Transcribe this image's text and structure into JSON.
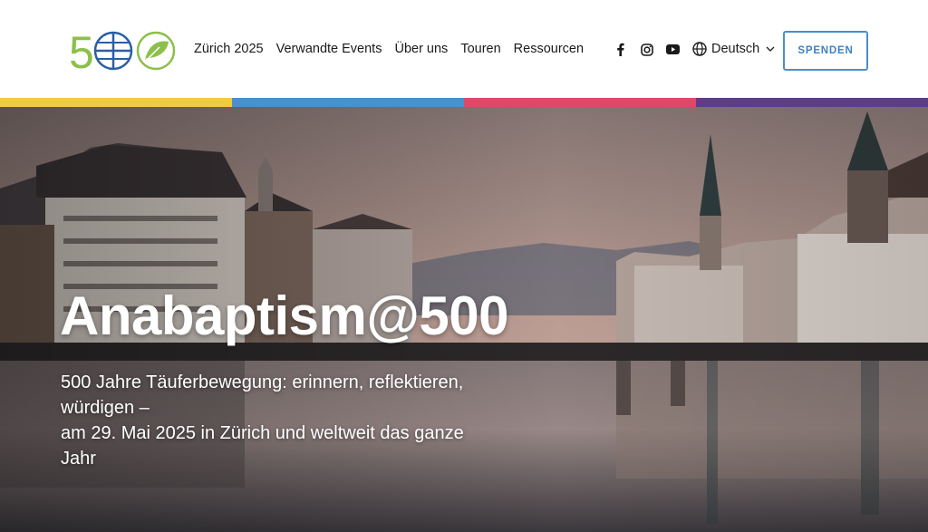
{
  "logo": {
    "text": "500",
    "icon": "anabaptism-500-logo",
    "colors": {
      "green": "#8cc04b",
      "blue": "#2b5fa3"
    }
  },
  "nav": {
    "items": [
      {
        "label": "Zürich 2025"
      },
      {
        "label": "Verwandte Events"
      },
      {
        "label": "Über uns"
      },
      {
        "label": "Touren"
      },
      {
        "label": "Ressourcen"
      }
    ]
  },
  "social": {
    "icons": [
      "facebook-icon",
      "instagram-icon",
      "youtube-icon"
    ]
  },
  "language": {
    "label": "Deutsch",
    "icon": "globe-icon"
  },
  "donate": {
    "label": "SPENDEN",
    "color": "#4a90c9"
  },
  "colorbar": {
    "colors": [
      "#f6c945",
      "#4a90c9",
      "#e0486a",
      "#5b3d8a"
    ]
  },
  "hero": {
    "title": "Anabaptism@500",
    "subtitle_lines": [
      "500 Jahre Täuferbewegung: erinnern, reflektieren,",
      "würdigen –",
      "am 29. Mai 2025 in Zürich und weltweit das ganze",
      "Jahr"
    ]
  }
}
